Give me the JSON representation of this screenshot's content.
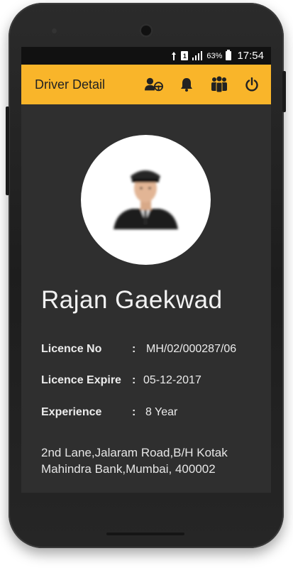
{
  "status_bar": {
    "sim_label": "1",
    "battery_percent": "63%",
    "time": "17:54",
    "icons": [
      "data-icon",
      "sim-icon",
      "signal-icon",
      "battery-icon"
    ]
  },
  "app_bar": {
    "title": "Driver Detail",
    "background_color": "#f9b52a",
    "actions": [
      "driver-profile-icon",
      "bell-icon",
      "group-icon",
      "power-icon"
    ]
  },
  "driver": {
    "name": "Rajan Gaekwad",
    "licence_no_label": "Licence No",
    "licence_no": "MH/02/000287/06",
    "licence_expire_label": "Licence Expire",
    "licence_expire": "05-12-2017",
    "experience_label": "Experience",
    "experience": "8 Year",
    "separator": ":",
    "address": "2nd Lane,Jalaram Road,B/H Kotak Mahindra Bank,Mumbai, 400002"
  }
}
